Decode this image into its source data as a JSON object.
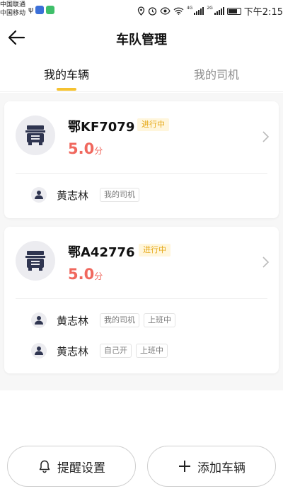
{
  "status_bar": {
    "carrier_1": "中国联通",
    "carrier_2": "中国移动",
    "net_tag_1": "4G",
    "net_tag_2": "2G",
    "time": "下午2:15",
    "icons": [
      "usb-icon",
      "app-icon",
      "app-icon",
      "location-icon",
      "alarm-icon",
      "eye-icon",
      "wifi-icon",
      "signal-icon",
      "signal-icon",
      "battery-icon"
    ]
  },
  "header": {
    "title": "车队管理",
    "back_icon": "arrow-left-icon"
  },
  "tabs": [
    {
      "label": "我的车辆",
      "active": true
    },
    {
      "label": "我的司机",
      "active": false
    }
  ],
  "vehicles": [
    {
      "plate": "鄂KF7079",
      "status": "进行中",
      "score": "5.0",
      "score_unit": "分",
      "drivers": [
        {
          "name": "黄志林",
          "tags": [
            "我的司机"
          ]
        }
      ]
    },
    {
      "plate": "鄂A42776",
      "status": "进行中",
      "score": "5.0",
      "score_unit": "分",
      "drivers": [
        {
          "name": "黄志林",
          "tags": [
            "我的司机",
            "上班中"
          ]
        },
        {
          "name": "黄志林",
          "tags": [
            "自己开",
            "上班中"
          ]
        }
      ]
    }
  ],
  "bottom": {
    "remind_label": "提醒设置",
    "add_label": "添加车辆"
  },
  "colors": {
    "accent": "#f5c231",
    "score": "#f0685e",
    "badge_bg": "#fff6dc",
    "badge_text": "#e6a817",
    "inactive_tab": "#8c8c8c"
  }
}
